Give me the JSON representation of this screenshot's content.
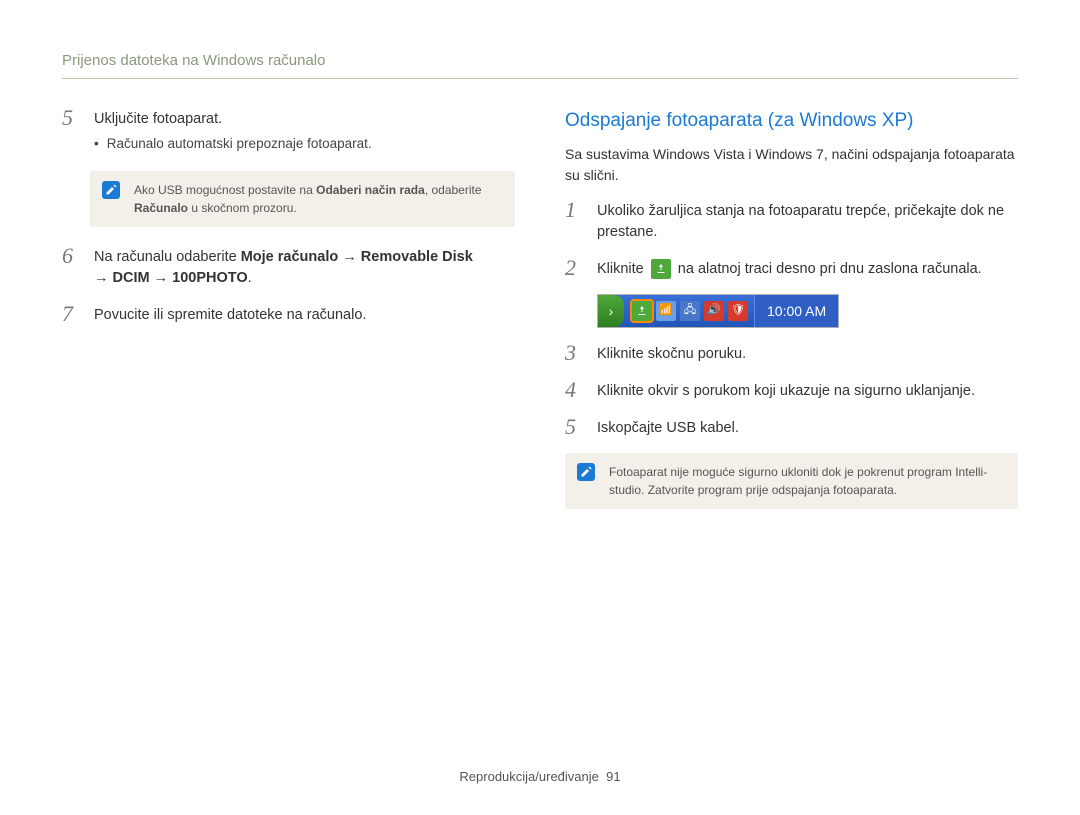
{
  "header": "Prijenos datoteka na Windows računalo",
  "left": {
    "step5": {
      "num": "5",
      "text": "Uključite fotoaparat.",
      "bullet": "Računalo automatski prepoznaje fotoaparat."
    },
    "note1": {
      "before": "Ako USB mogućnost postavite na ",
      "bold1": "Odaberi način rada",
      "mid": ", odaberite ",
      "bold2": "Računalo",
      "after": " u skočnom prozoru."
    },
    "step6": {
      "num": "6",
      "prefix": "Na računalu odaberite ",
      "b1": "Moje računalo",
      "arr": " → ",
      "b2": "Removable Disk",
      "b3": "DCIM",
      "b4": "100PHOTO",
      "suffix": "."
    },
    "step7": {
      "num": "7",
      "text": "Povucite ili spremite datoteke na računalo."
    }
  },
  "right": {
    "title": "Odspajanje fotoaparata (za Windows XP)",
    "intro": "Sa sustavima Windows Vista i Windows 7, načini odspajanja fotoaparata su slični.",
    "step1": {
      "num": "1",
      "text": "Ukoliko žaruljica stanja na fotoaparatu trepće, pričekajte dok ne prestane."
    },
    "step2": {
      "num": "2",
      "before": "Kliknite ",
      "after": " na alatnoj traci desno pri dnu zaslona računala."
    },
    "taskbar_time": "10:00 AM",
    "step3": {
      "num": "3",
      "text": "Kliknite skočnu poruku."
    },
    "step4": {
      "num": "4",
      "text": "Kliknite okvir s porukom koji ukazuje na sigurno uklanjanje."
    },
    "step5b": {
      "num": "5",
      "text": "Iskopčajte USB kabel."
    },
    "note2": "Fotoaparat nije moguće sigurno ukloniti dok je pokrenut program Intelli-studio. Zatvorite program prije odspajanja fotoaparata."
  },
  "footer": {
    "label": "Reprodukcija/uređivanje",
    "page": "91"
  }
}
